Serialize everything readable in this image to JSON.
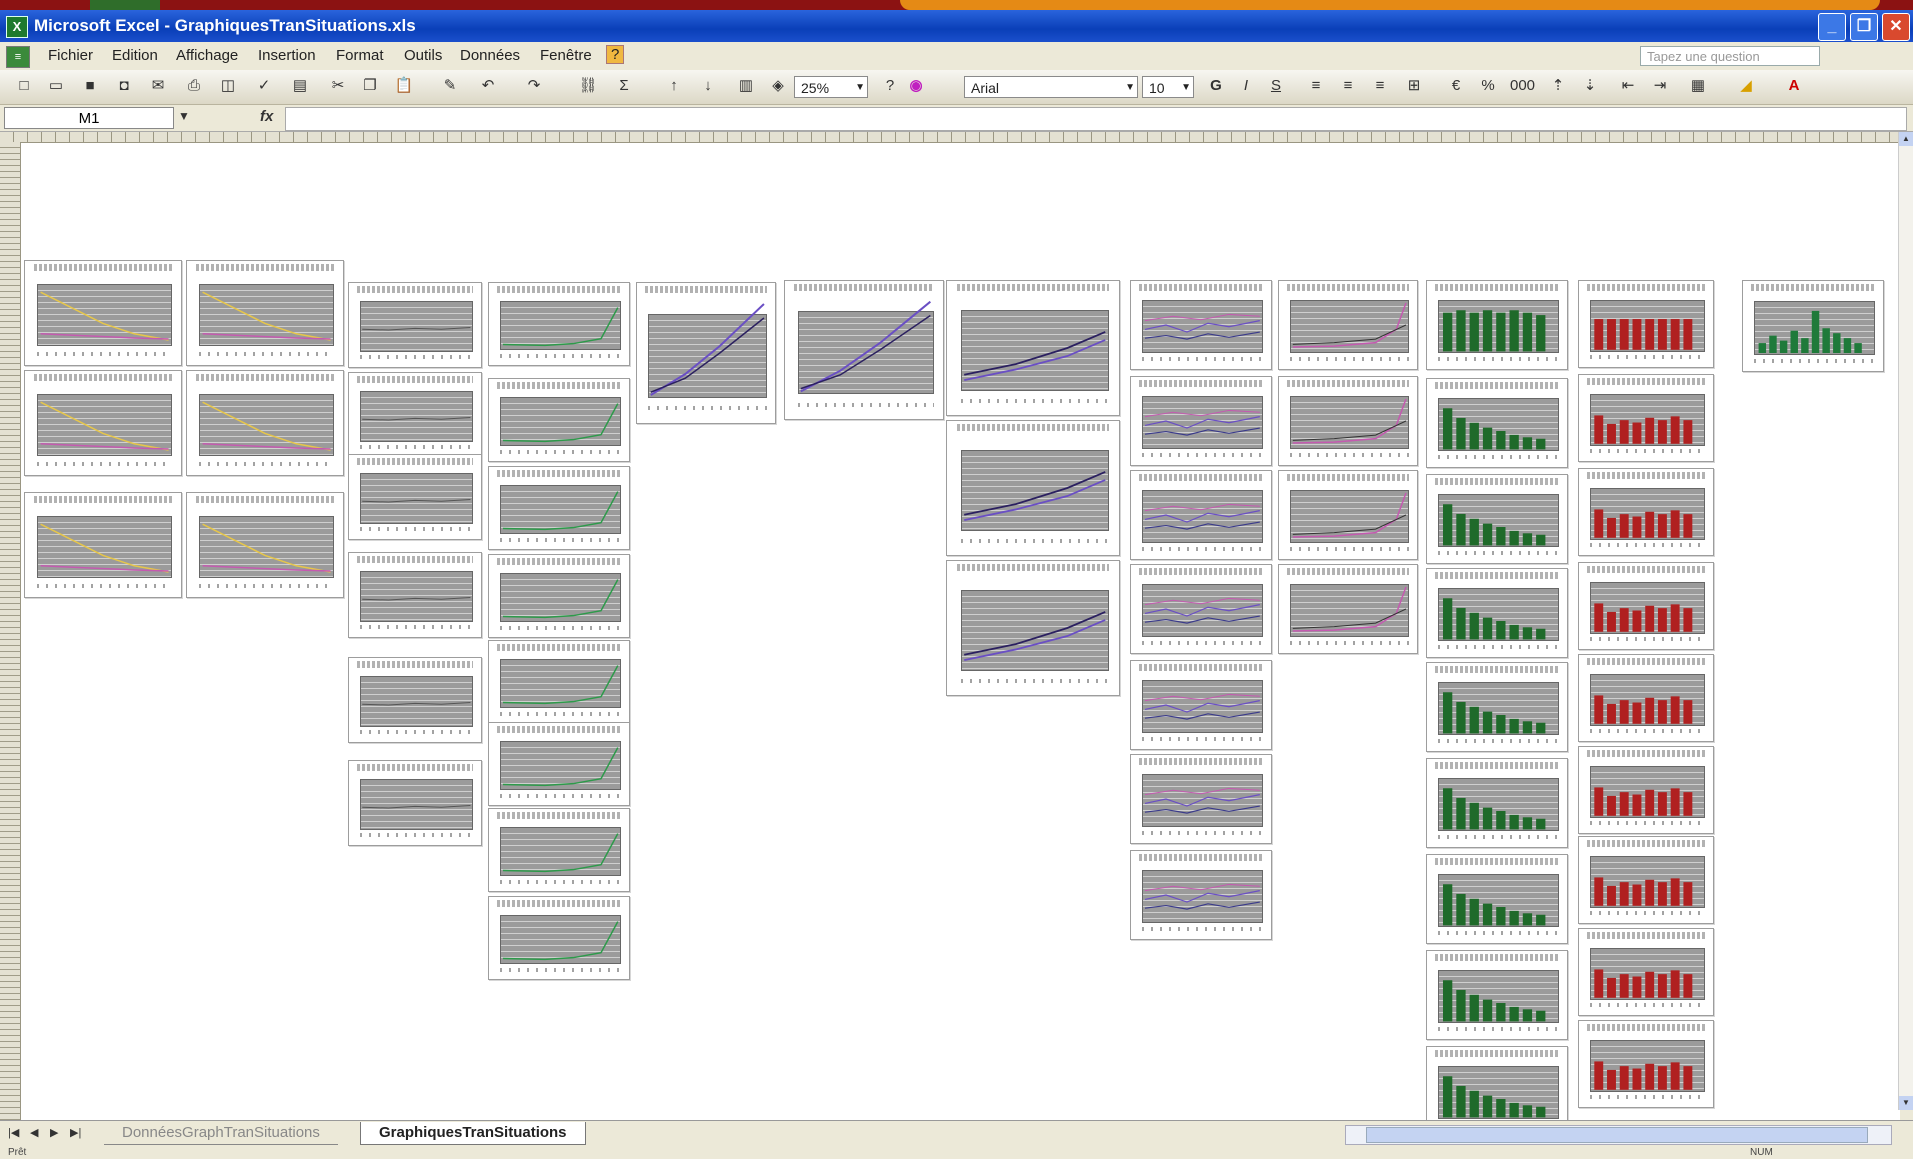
{
  "window": {
    "title": "Microsoft Excel - GraphiquesTranSituations.xls",
    "app_icon": "excel-icon",
    "controls": {
      "minimize": "_",
      "restore": "❐",
      "close": "✕"
    }
  },
  "menu": {
    "items": [
      "Fichier",
      "Edition",
      "Affichage",
      "Insertion",
      "Format",
      "Outils",
      "Données",
      "Fenêtre",
      "?"
    ],
    "help_placeholder": "Tapez une question"
  },
  "toolbar": {
    "zoom": "25%",
    "font": "Arial",
    "font_size": "10",
    "bold": "G",
    "italic": "I",
    "underline": "S",
    "sum": "Σ",
    "percent": "%"
  },
  "formula_bar": {
    "name_box": "M1",
    "fx": "fx",
    "content": ""
  },
  "sheet": {
    "embedded_charts": "many miniature charts (line and bar)",
    "colors": {
      "purple_line": "#6a4fc4",
      "dark_line": "#2b2060",
      "green_line": "#2d9a4a",
      "yellow_line": "#e6c64a",
      "pink_line": "#c45ab0",
      "green_bar": "#1f6a2a",
      "red_bar": "#b02020"
    }
  },
  "sheet_tabs": {
    "tabs": [
      "DonnéesGraphTranSituations",
      "GraphiquesTranSituations"
    ],
    "active": "GraphiquesTranSituations"
  },
  "status": {
    "left": "Prêt",
    "right": "NUM"
  }
}
